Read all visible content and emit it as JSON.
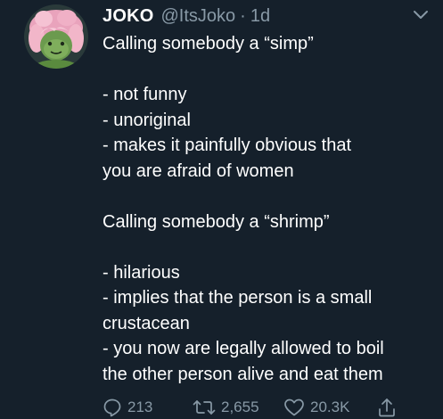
{
  "tweet": {
    "author_name": "JOKO",
    "handle": "@ItsJoko",
    "separator": "·",
    "time": "1d",
    "lines": [
      "Calling somebody a “simp”",
      "",
      "- not funny",
      "- unoriginal",
      "- makes it painfully obvious that",
      "you are afraid of women",
      "",
      "Calling somebody a “shrimp”",
      "",
      "- hilarious",
      "- implies that the person is a small",
      "crustacean",
      "- you now are legally allowed to boil",
      "the other person alive and eat them"
    ]
  },
  "actions": {
    "reply_count": "213",
    "retweet_count": "2,655",
    "like_count": "20.3K"
  },
  "icons": {
    "reply": "reply-icon",
    "retweet": "retweet-icon",
    "like": "heart-icon",
    "share": "share-icon",
    "menu": "chevron-down-icon"
  },
  "colors": {
    "background": "#15202b",
    "text": "#ffffff",
    "muted": "#8899a6"
  }
}
